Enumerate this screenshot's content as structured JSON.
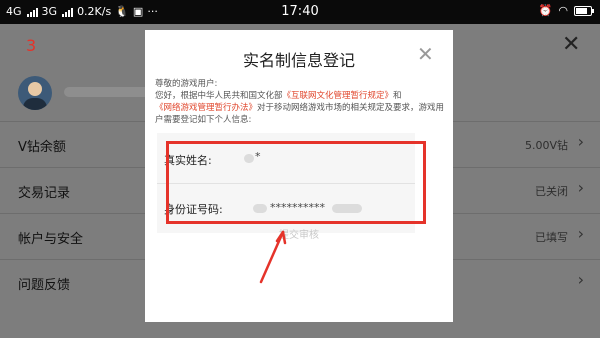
{
  "status_bar": {
    "network1": "4G",
    "network2": "3G",
    "speed": "0.2K/s",
    "time": "17:40",
    "battery_level": 0.8
  },
  "background": {
    "step_number": "3",
    "rows": [
      {
        "label": "V钻余额",
        "value": "5.00V钻"
      },
      {
        "label": "交易记录",
        "value": "已关闭"
      },
      {
        "label": "帐户与安全",
        "value": "已填写"
      },
      {
        "label": "问题反馈",
        "value": ""
      }
    ]
  },
  "dialog": {
    "title": "实名制信息登记",
    "notice_prefix": "尊敬的游戏用户:\n您好，根据中华人民共和国文化部",
    "link1": "《互联网文化管理暂行规定》",
    "notice_and": "和",
    "link2": "《网络游戏管理暂行办法》",
    "notice_suffix": "对于移动网络游戏市场的相关规定及要求，游戏用户需要登记如下个人信息:",
    "name_label": "真实姓名:",
    "name_value": "*",
    "id_label": "身份证号码:",
    "id_value": "**********",
    "submit_label": "提交审核"
  },
  "colors": {
    "accent": "#e5332a",
    "link": "#e0462c",
    "overlay": "#7d7d7d"
  }
}
